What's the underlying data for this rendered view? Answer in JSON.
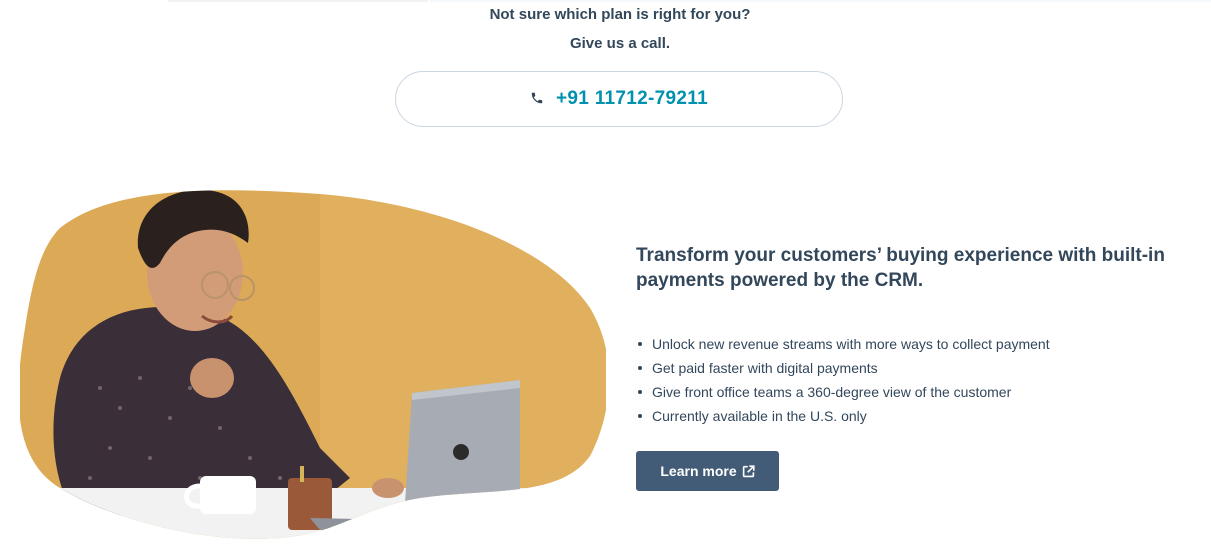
{
  "call_section": {
    "question": "Not sure which plan is right for you?",
    "prompt": "Give us a call.",
    "phone_icon": "phone-icon",
    "phone_number": "+91 11712-79211"
  },
  "feature": {
    "heading": "Transform your customers’ buying experience with built-in payments powered by the CRM.",
    "bullets": [
      "Unlock new revenue streams with more ways to collect payment",
      "Get paid faster with digital payments",
      "Give front office teams a 360-degree view of the customer",
      "Currently available in the U.S. only"
    ],
    "button_label": "Learn more",
    "button_icon": "external-link-icon"
  },
  "colors": {
    "heading": "#33475b",
    "phone_link": "#0091ae",
    "button_bg": "#425b76",
    "photo_backdrop": "#dcaa56"
  }
}
